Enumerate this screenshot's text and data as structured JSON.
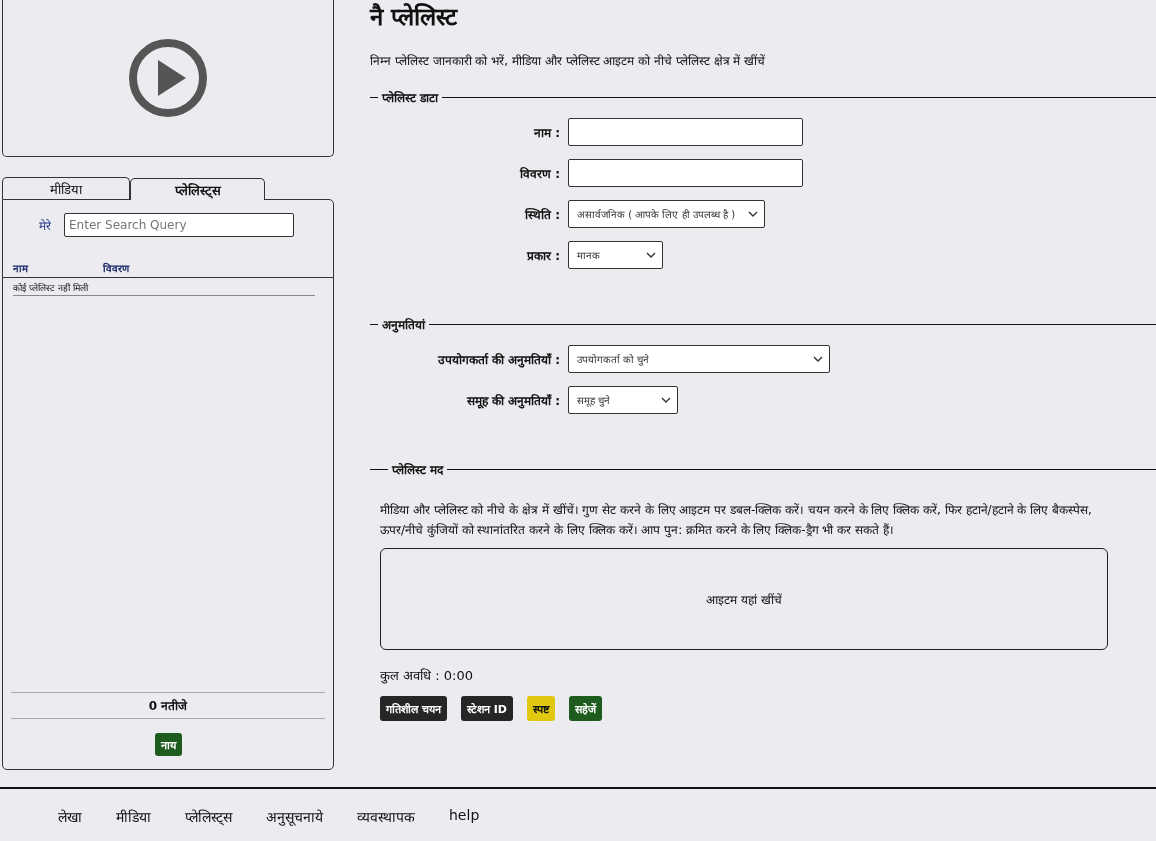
{
  "sidebar": {
    "tabs": [
      {
        "label": "मीडिया",
        "selected": false
      },
      {
        "label": "प्लेलिस्ट्स",
        "selected": true
      }
    ],
    "search": {
      "label": "मेरे",
      "placeholder": "Enter Search Query"
    },
    "table": {
      "columns": [
        "नाम",
        "विवरण"
      ],
      "empty_message": "कोई प्लेलिस्ट नहीं मिली"
    },
    "result_count": "0 नतीजे",
    "new_button": "नाय"
  },
  "page": {
    "title": "नै प्लेलिस्ट",
    "intro": "निम्न प्लेलिस्ट जानकारी को भरें, मीडिया और प्लेलिस्ट आइटम को नीचे प्लेलिस्ट क्षेत्र में खींचें"
  },
  "playlist_data": {
    "legend": "प्लेलिस्ट डाटा",
    "fields": [
      {
        "kind": "text",
        "label": "नाम :"
      },
      {
        "kind": "text",
        "label": "विवरण :"
      },
      {
        "kind": "select",
        "label": "स्थिति :",
        "value": "असार्वजनिक ( आपके लिए ही उपलब्ध है )"
      },
      {
        "kind": "select",
        "label": "प्रकार :",
        "value": "मानक"
      }
    ]
  },
  "permissions": {
    "legend": "अनुमतियां",
    "fields": [
      {
        "kind": "select",
        "label": "उपयोगकर्ता की अनुमतियाँ :",
        "value": "उपयोगकर्ता को चुने"
      },
      {
        "kind": "select",
        "label": "समूह की अनुमतियाँ :",
        "value": "समूह चुने"
      }
    ]
  },
  "playlist_items": {
    "legend": "प्लेलिस्ट मद",
    "help": "मीडिया और प्लेलिस्ट को नीचे के क्षेत्र में खींचें। गुण सेट करने के लिए आइटम पर डबल-क्लिक करें। चयन करने के लिए क्लिक करें, फिर हटाने/हटाने के लिए बैकस्पेस, ऊपर/नीचे कुंजियों को स्थानांतरित करने के लिए क्लिक करें। आप पुन: क्रमित करने के लिए क्लिक-ड्रैग भी कर सकते हैं।",
    "drop_zone": "आइटम यहां खींचें",
    "total_duration": "कुल अवधि : 0:00"
  },
  "actions": [
    {
      "label": "गतिशील चयन",
      "kind": "dark"
    },
    {
      "label": "स्टेशन ID",
      "kind": "dark"
    },
    {
      "label": "स्पष्ट",
      "kind": "warning"
    },
    {
      "label": "सहेजें",
      "kind": "success"
    }
  ],
  "footer_nav": [
    "लेखा",
    "मीडिया",
    "प्लेलिस्ट्स",
    "अनुसूचनाये",
    "व्यवस्थापक",
    "help"
  ]
}
